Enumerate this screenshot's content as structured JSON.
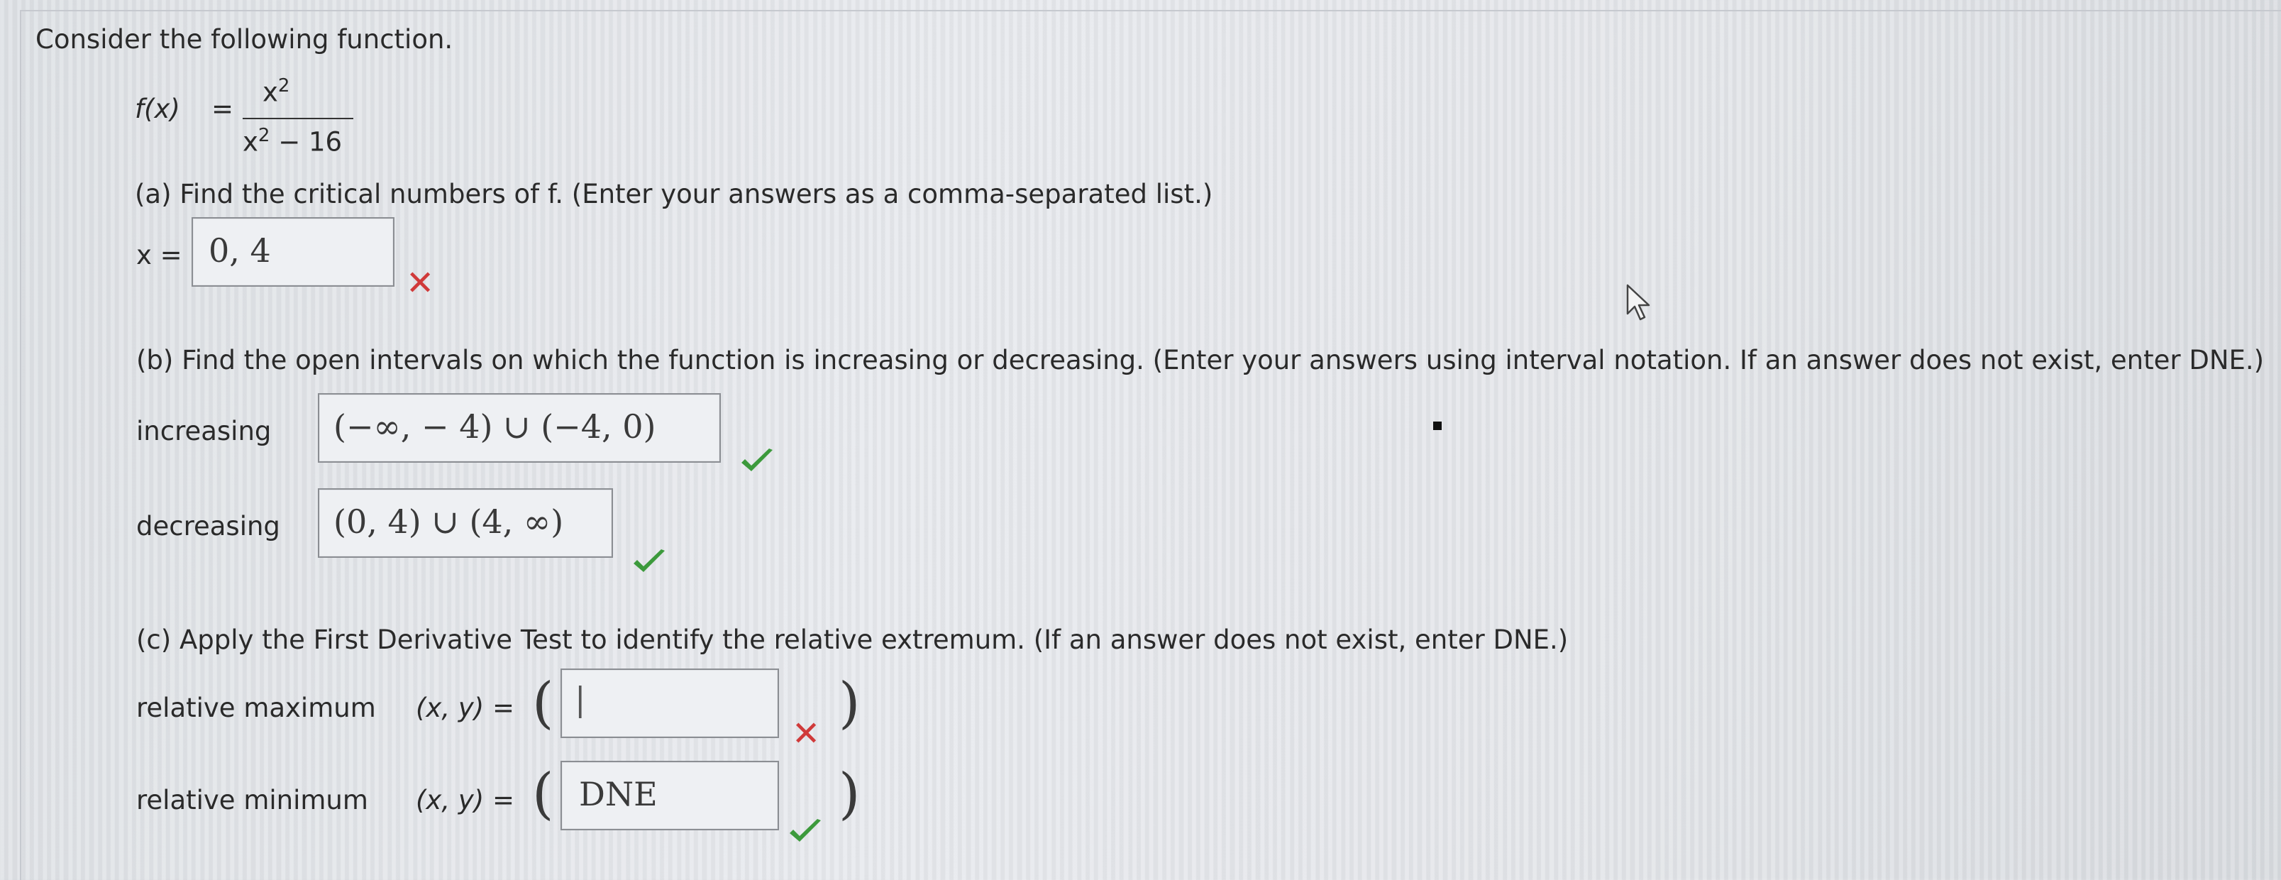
{
  "intro": "Consider the following function.",
  "function": {
    "lhs": "f(x)",
    "equals": "=",
    "numerator": "x",
    "numerator_exp": "2",
    "denominator": "x",
    "denominator_exp": "2",
    "denominator_rest": " − 16"
  },
  "part_a": {
    "prompt": "(a) Find the critical numbers of f. (Enter your answers as a comma-separated list.)",
    "label": "x =",
    "answer": "0, 4",
    "status": "incorrect",
    "mark": "✕"
  },
  "part_b": {
    "prompt": "(b) Find the open intervals on which the function is increasing or decreasing. (Enter your answers using interval notation. If an answer does not exist, enter DNE.)",
    "increasing_label": "increasing",
    "increasing_answer": "(−∞, − 4) ∪ (−4, 0)",
    "increasing_status": "correct",
    "decreasing_label": "decreasing",
    "decreasing_answer": "(0, 4) ∪ (4, ∞)",
    "decreasing_status": "correct"
  },
  "part_c": {
    "prompt": "(c) Apply the First Derivative Test to identify the relative extremum. (If an answer does not exist, enter DNE.)",
    "max_label": "relative maximum",
    "max_eq": "(x, y)  =",
    "max_answer": "|",
    "max_status": "incorrect",
    "max_mark": "✕",
    "min_label": "relative minimum",
    "min_eq": "(x, y)  =",
    "min_answer": "DNE",
    "min_status": "correct",
    "open_paren": "(",
    "close_paren": ")"
  },
  "colors": {
    "incorrect": "#d03a3a",
    "correct": "#3c9a3c"
  }
}
